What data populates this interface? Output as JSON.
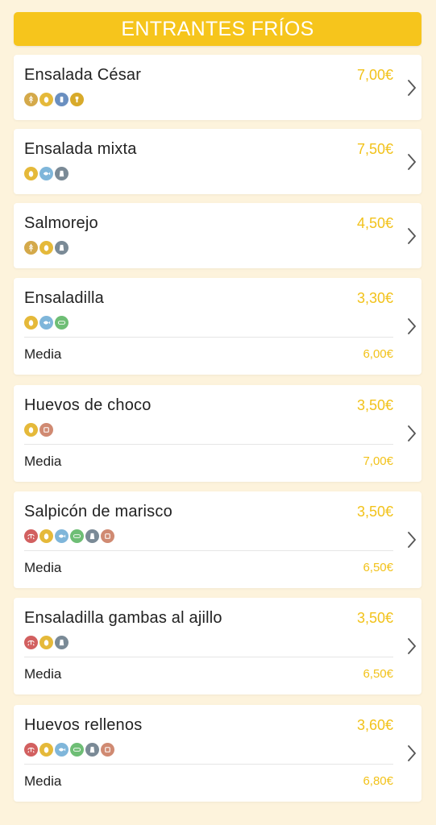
{
  "header": {
    "title": "ENTRANTES FRÍOS"
  },
  "allergen_colors": {
    "gluten": "#d4a94a",
    "egg": "#e5b93a",
    "milk": "#6a8fc0",
    "mustard": "#d8aa2a",
    "fish": "#7fb6da",
    "sulphites": "#7a8a96",
    "crustaceans": "#d26060",
    "celery": "#6ebe75",
    "nuts": "#d08a72"
  },
  "items": [
    {
      "name": "Ensalada César",
      "price": "7,00€",
      "allergens": [
        "gluten",
        "egg",
        "milk",
        "mustard"
      ]
    },
    {
      "name": "Ensalada mixta",
      "price": "7,50€",
      "allergens": [
        "egg",
        "fish",
        "sulphites"
      ]
    },
    {
      "name": "Salmorejo",
      "price": "4,50€",
      "allergens": [
        "gluten",
        "egg",
        "sulphites"
      ]
    },
    {
      "name": "Ensaladilla",
      "price": "3,30€",
      "allergens": [
        "egg",
        "fish",
        "celery"
      ],
      "half_label": "Media",
      "half_price": "6,00€"
    },
    {
      "name": "Huevos de choco",
      "price": "3,50€",
      "allergens": [
        "egg",
        "nuts"
      ],
      "half_label": "Media",
      "half_price": "7,00€"
    },
    {
      "name": "Salpicón de marisco",
      "price": "3,50€",
      "allergens": [
        "crustaceans",
        "egg",
        "fish",
        "celery",
        "sulphites",
        "nuts"
      ],
      "half_label": "Media",
      "half_price": "6,50€"
    },
    {
      "name": "Ensaladilla gambas al ajillo",
      "price": "3,50€",
      "allergens": [
        "crustaceans",
        "egg",
        "sulphites"
      ],
      "half_label": "Media",
      "half_price": "6,50€"
    },
    {
      "name": "Huevos rellenos",
      "price": "3,60€",
      "allergens": [
        "crustaceans",
        "egg",
        "fish",
        "celery",
        "sulphites",
        "nuts"
      ],
      "half_label": "Media",
      "half_price": "6,80€"
    }
  ]
}
